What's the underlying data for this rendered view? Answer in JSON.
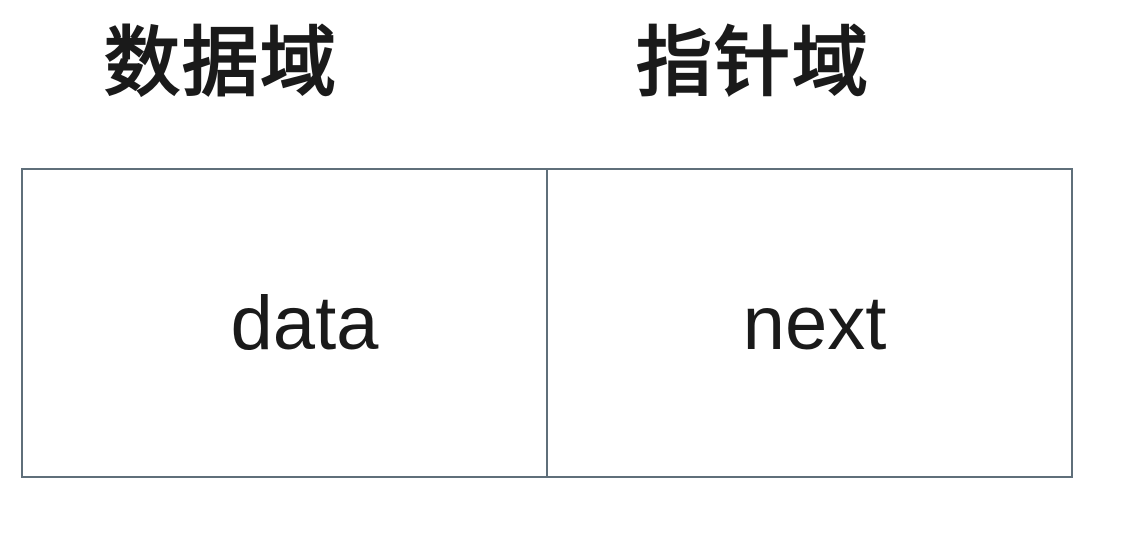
{
  "headings": {
    "data_field": "数据域",
    "pointer_field": "指针域"
  },
  "node": {
    "data_cell": "data",
    "next_cell": "next"
  }
}
